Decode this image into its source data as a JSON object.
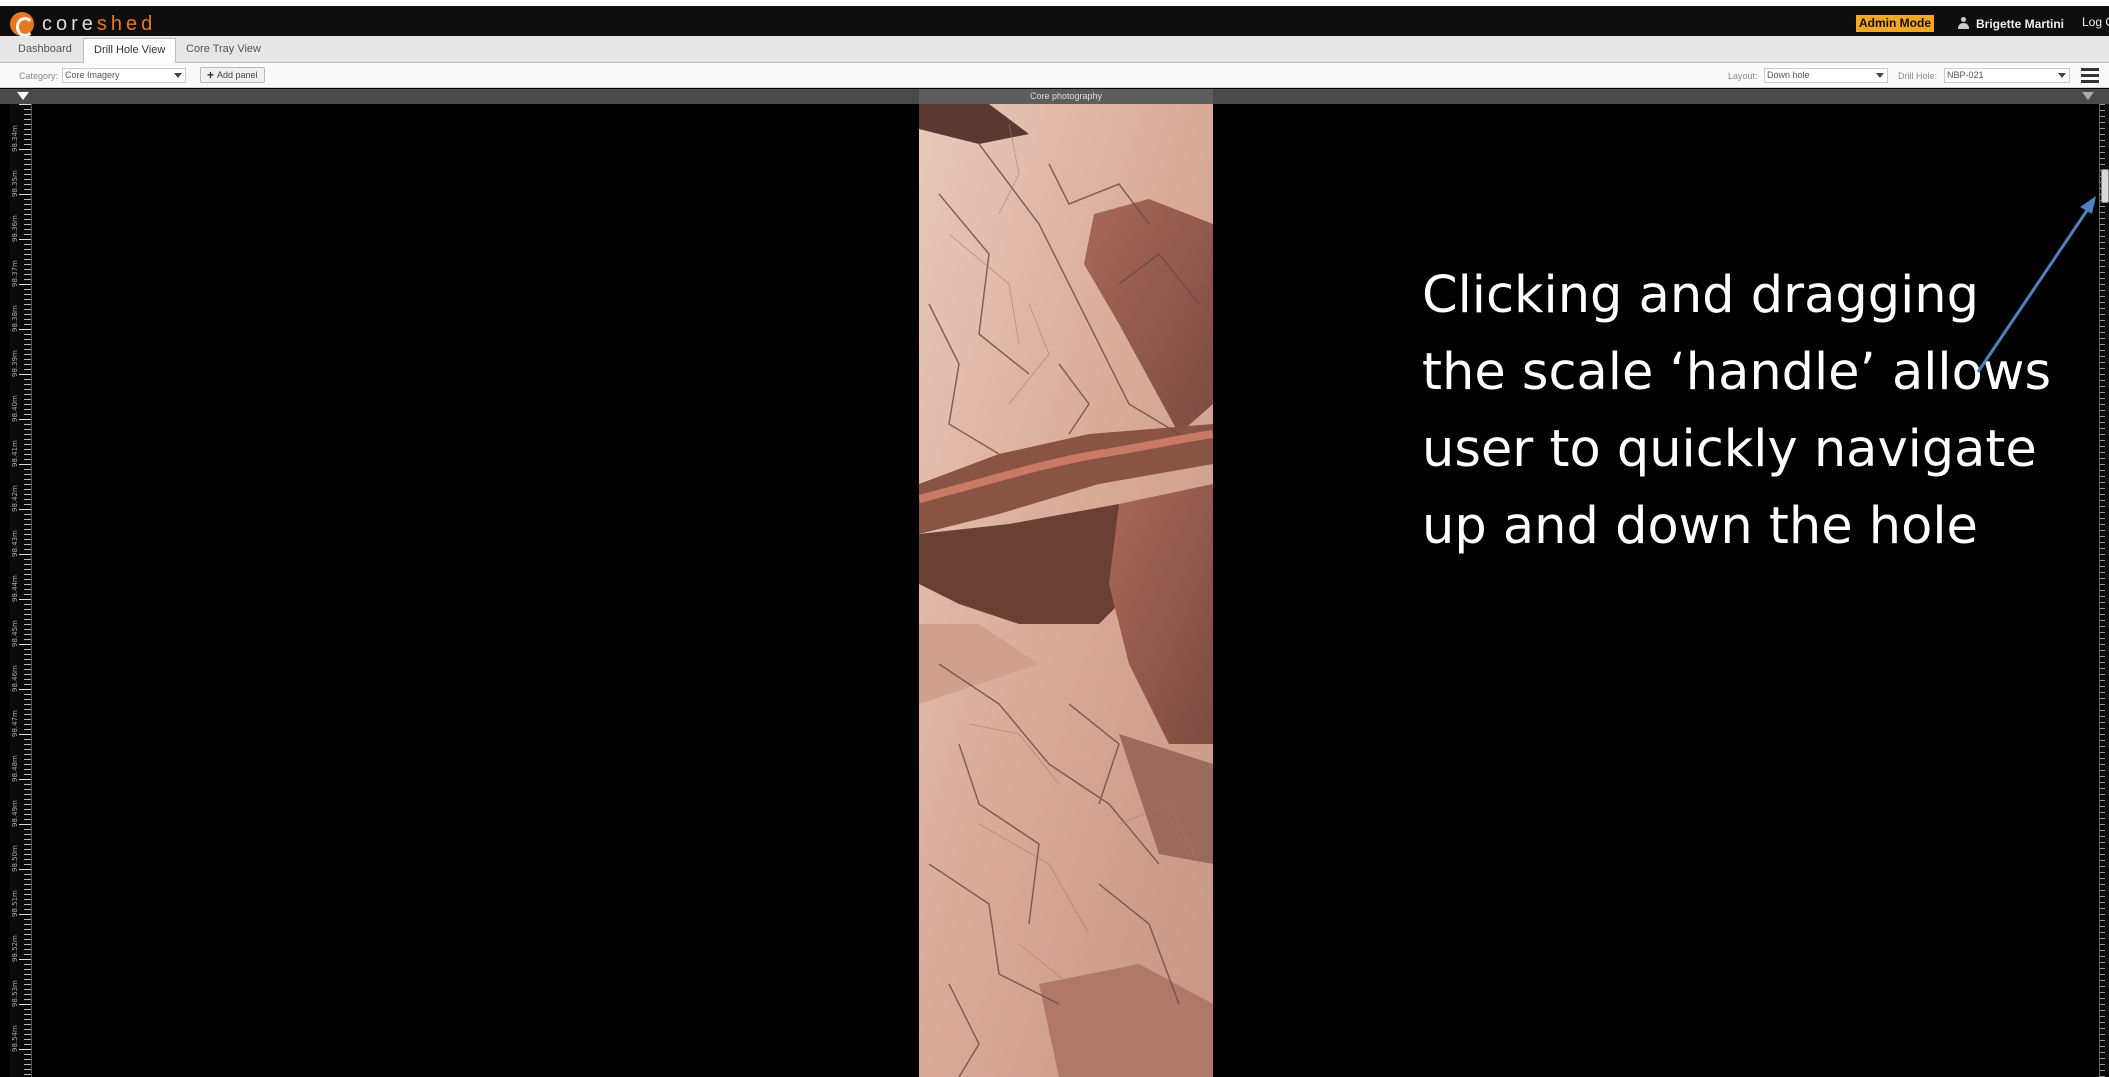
{
  "header": {
    "logo_core": "core",
    "logo_shed": "shed",
    "admin_badge": "Admin Mode",
    "user_name": "Brigette Martini",
    "logout": "Log Out"
  },
  "tabs": [
    {
      "label": "Dashboard",
      "active": false
    },
    {
      "label": "Drill Hole View",
      "active": true
    },
    {
      "label": "Core Tray View",
      "active": false
    }
  ],
  "toolbar": {
    "category_label": "Category:",
    "category_value": "Core Imagery",
    "add_panel_label": "Add panel",
    "layout_label": "Layout:",
    "layout_value": "Down hole",
    "drillhole_label": "Drill Hole:",
    "drillhole_value": "NBP-021"
  },
  "panel": {
    "title": "Core photography"
  },
  "depth_scale": [
    "98.34m",
    "98.35m",
    "98.36m",
    "98.37m",
    "98.38m",
    "98.39m",
    "98.40m",
    "98.41m",
    "98.42m",
    "98.43m",
    "98.44m",
    "98.45m",
    "98.46m",
    "98.47m",
    "98.48m",
    "98.49m",
    "98.50m",
    "98.51m",
    "98.52m",
    "98.53m",
    "98.54m"
  ],
  "annotation": {
    "text": "Clicking and dragging\nthe scale ‘handle’ allows\nuser to quickly navigate\nup and down the hole",
    "arrow_color": "#4f81bd"
  },
  "colors": {
    "accent": "#e87722",
    "admin_badge": "#f5a623"
  }
}
